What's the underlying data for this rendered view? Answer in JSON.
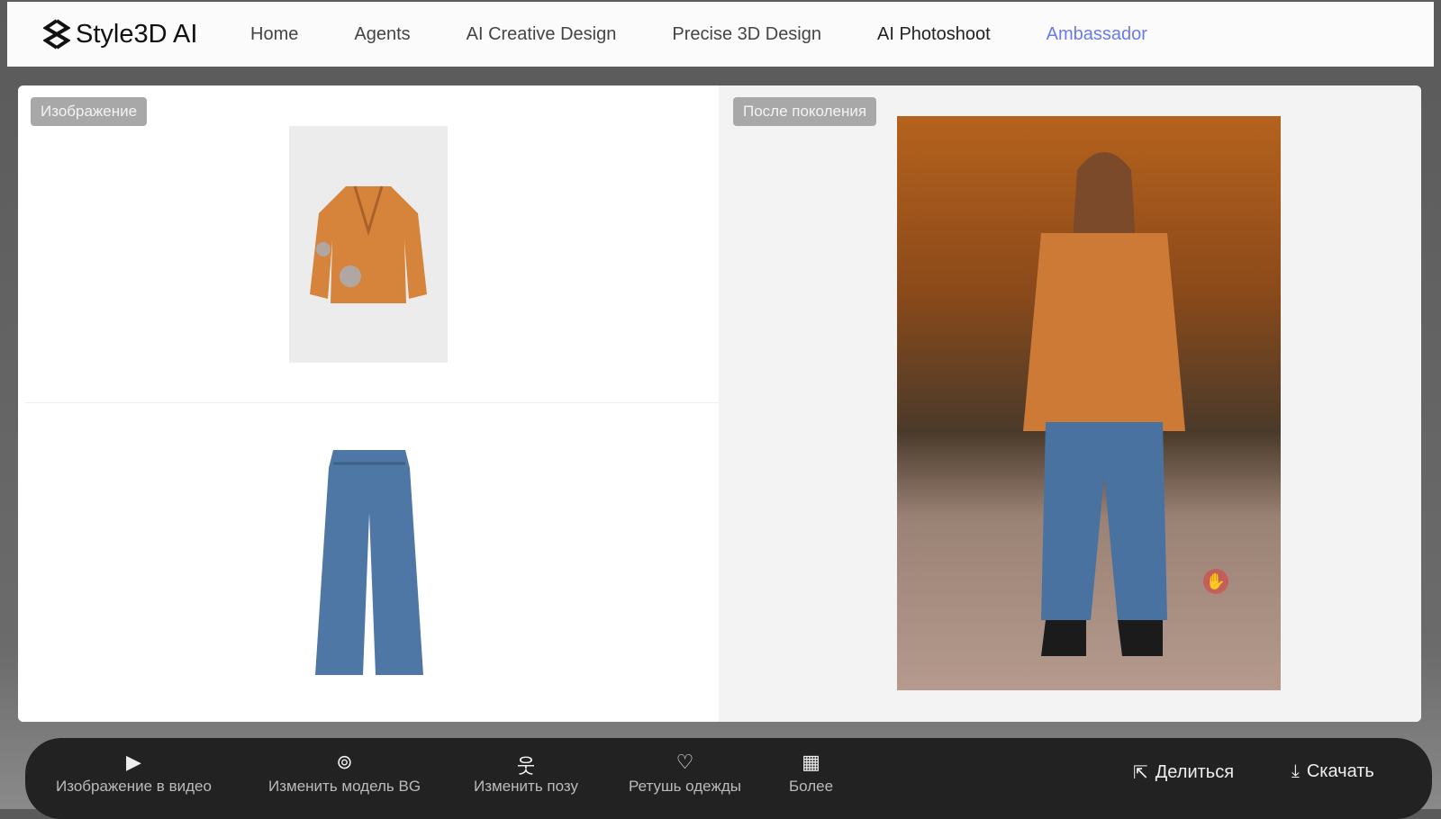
{
  "nav": {
    "brand": "Style3D AI",
    "items": [
      "Home",
      "Agents",
      "AI Creative Design",
      "Precise 3D Design",
      "AI Photoshoot",
      "Ambassador"
    ],
    "active": "Ambassador",
    "accent": "#6b7ae8"
  },
  "left_panel": {
    "tag": "Изображение"
  },
  "right_panel": {
    "tag": "После поколения"
  },
  "toolbar": {
    "tools": [
      {
        "icon": "video-icon",
        "label": "Изображение в видео"
      },
      {
        "icon": "change-model-icon",
        "label": "Изменить модель BG"
      },
      {
        "icon": "pose-icon",
        "label": "Изменить позу"
      },
      {
        "icon": "retouch-icon",
        "label": "Ретушь одежды"
      },
      {
        "icon": "more-icon",
        "label": "Более"
      }
    ],
    "share": "Делиться",
    "download": "Скачать"
  }
}
